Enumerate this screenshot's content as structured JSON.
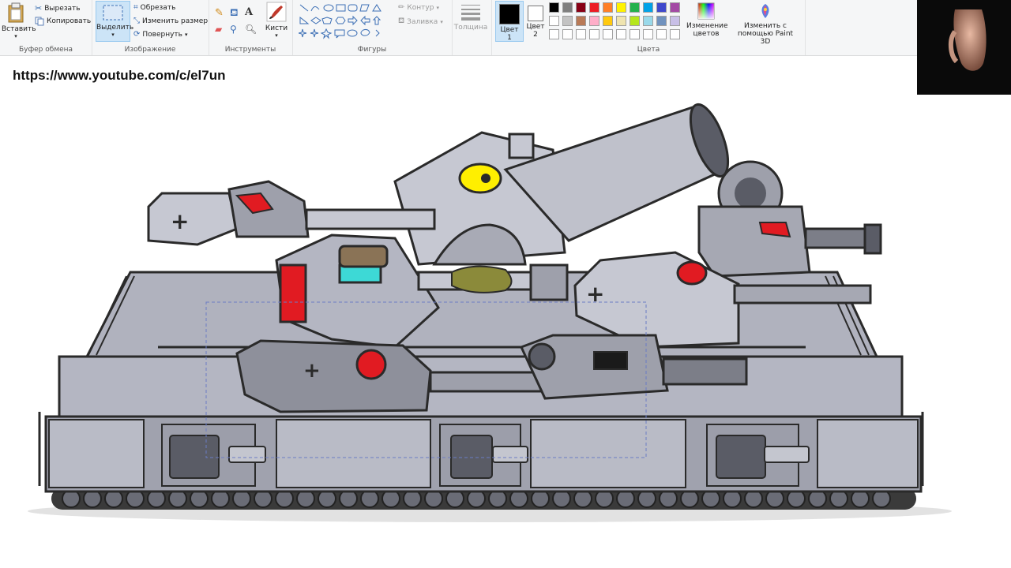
{
  "ribbon": {
    "clipboard": {
      "paste": "Вставить",
      "cut": "Вырезать",
      "copy": "Копировать",
      "group": "Буфер обмена"
    },
    "image": {
      "select": "Выделить",
      "crop": "Обрезать",
      "resize": "Изменить размер",
      "rotate": "Повернуть",
      "group": "Изображение"
    },
    "tools": {
      "group": "Инструменты",
      "brushes": "Кисти"
    },
    "shapes": {
      "outline": "Контур",
      "fill": "Заливка",
      "group": "Фигуры"
    },
    "size": {
      "label": "Толщина"
    },
    "colors": {
      "color1": "Цвет 1",
      "color2": "Цвет 2",
      "edit": "Изменение цветов",
      "paint3d": "Изменить с помощью Paint 3D",
      "group": "Цвета",
      "color1_value": "#000000",
      "color2_value": "#ffffff",
      "palette_row1": [
        "#000000",
        "#7f7f7f",
        "#880015",
        "#ed1c24",
        "#ff7f27",
        "#fff200",
        "#22b14c",
        "#00a2e8",
        "#3f48cc",
        "#a349a4"
      ],
      "palette_row2": [
        "#ffffff",
        "#c3c3c3",
        "#b97a57",
        "#ffaec9",
        "#ffc90e",
        "#efe4b0",
        "#b5e61d",
        "#99d9ea",
        "#7092be",
        "#c8bfe7"
      ]
    }
  },
  "canvas": {
    "url_text": "https://www.youtube.com/c/el7un"
  }
}
